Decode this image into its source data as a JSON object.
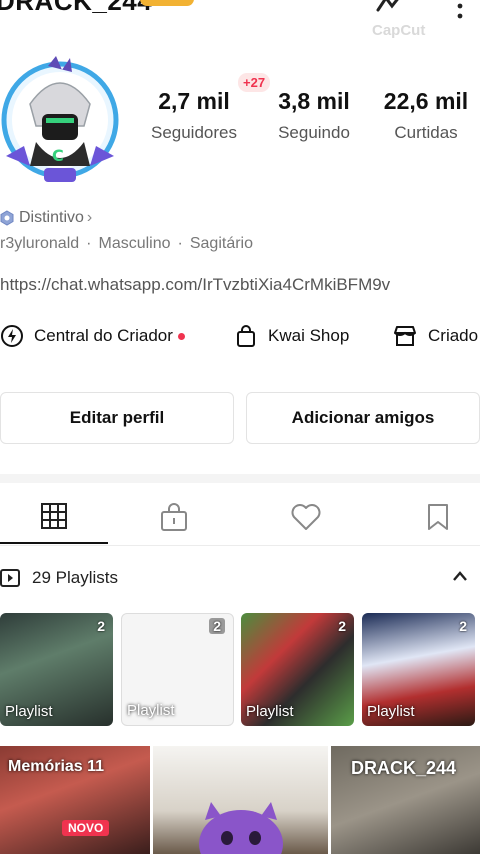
{
  "header": {
    "username": "DRACK_244",
    "watermark": "CapCut"
  },
  "stats": {
    "followers": {
      "value": "2,7 mil",
      "label": "Seguidores"
    },
    "following": {
      "value": "3,8 mil",
      "label": "Seguindo",
      "new_count": "+27"
    },
    "likes": {
      "value": "22,6 mil",
      "label": "Curtidas"
    }
  },
  "profile": {
    "badge": "Distintivo",
    "handle": "r3yluronald",
    "gender": "Masculino",
    "sign": "Sagitário",
    "link": "https://chat.whatsapp.com/IrTvzbtiXia4CrMkiBFM9v"
  },
  "shortcuts": [
    {
      "label": "Central do Criador",
      "icon": "lightning-icon",
      "dot": true
    },
    {
      "label": "Kwai Shop",
      "icon": "shopping-bag-icon"
    },
    {
      "label": "Criado",
      "icon": "store-icon"
    }
  ],
  "buttons": {
    "edit": "Editar perfil",
    "add": "Adicionar amigos"
  },
  "tabs": [
    {
      "icon": "grid-icon",
      "active": true
    },
    {
      "icon": "lock-icon"
    },
    {
      "icon": "heart-icon"
    },
    {
      "icon": "bookmark-icon"
    }
  ],
  "playlists": {
    "header": "29 Playlists",
    "items": [
      {
        "label": "Playlist",
        "count": "2"
      },
      {
        "label": "Playlist",
        "count": "2"
      },
      {
        "label": "Playlist",
        "count": "2"
      },
      {
        "label": "Playlist",
        "count": "2"
      }
    ]
  },
  "videos": {
    "memories_title": "Memórias 11",
    "memories_badge": "NOVO",
    "overlay_text": "DRACK_244"
  },
  "colors": {
    "accent": "#f0334f",
    "badge": "#f2b233",
    "avatar_ring": "#3fa8e6"
  }
}
